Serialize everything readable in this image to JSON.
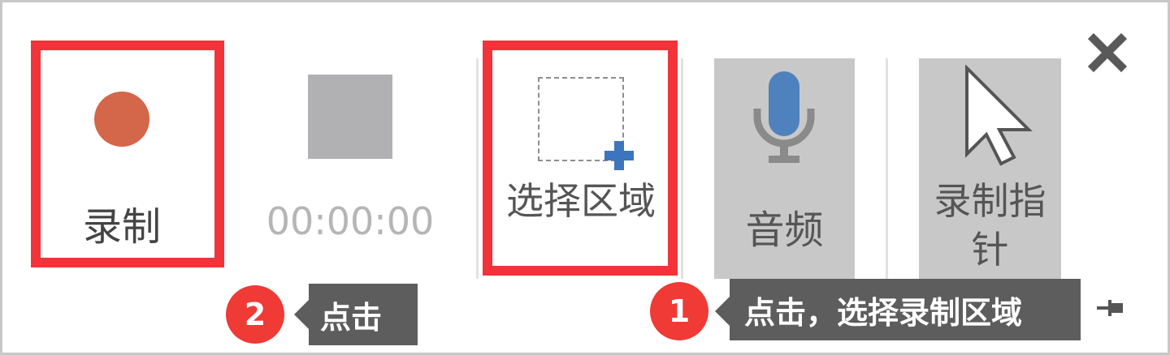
{
  "toolbar": {
    "record_label": "录制",
    "timer": "00:00:00",
    "select_area_label": "选择区域",
    "audio_label": "音频",
    "record_pointer_label": "录制指针"
  },
  "callouts": [
    {
      "number": "1",
      "text": "点击，选择录制区域"
    },
    {
      "number": "2",
      "text": "点击"
    }
  ],
  "colors": {
    "record_dot": "#d4664a",
    "highlight_red": "#f2333a",
    "callout_badge": "#ef3a35",
    "callout_bg": "#5d5d5d",
    "microphone": "#4f81bd",
    "plus": "#3d75bd",
    "toggle_bg": "#c8c8c8"
  },
  "icons": [
    "record-icon",
    "stop-icon",
    "select-area-icon",
    "microphone-icon",
    "pointer-icon",
    "close-icon",
    "pin-icon"
  ]
}
